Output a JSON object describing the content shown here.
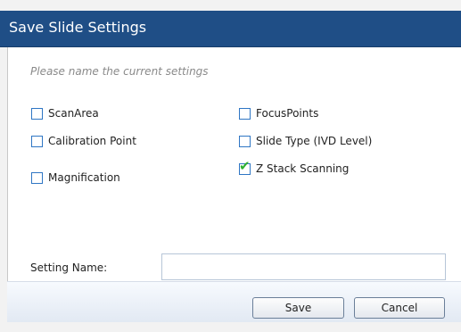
{
  "dialog": {
    "title": "Save Slide Settings",
    "hint": "Please name the current settings"
  },
  "options": {
    "scan_area": {
      "label": "ScanArea",
      "checked": false
    },
    "calibration_point": {
      "label": "Calibration Point",
      "checked": false
    },
    "magnification": {
      "label": "Magnification",
      "checked": false
    },
    "focus_points": {
      "label": "FocusPoints",
      "checked": false
    },
    "slide_type": {
      "label": "Slide Type (IVD Level)",
      "checked": false
    },
    "z_stack": {
      "label": "Z Stack Scanning",
      "checked": true
    }
  },
  "setting_name": {
    "label": "Setting Name:",
    "value": ""
  },
  "buttons": {
    "save": "Save",
    "cancel": "Cancel"
  },
  "colors": {
    "titlebar": "#1f4e86",
    "checkbox_border": "#2f76c4",
    "checkmark": "#2fb02f"
  }
}
